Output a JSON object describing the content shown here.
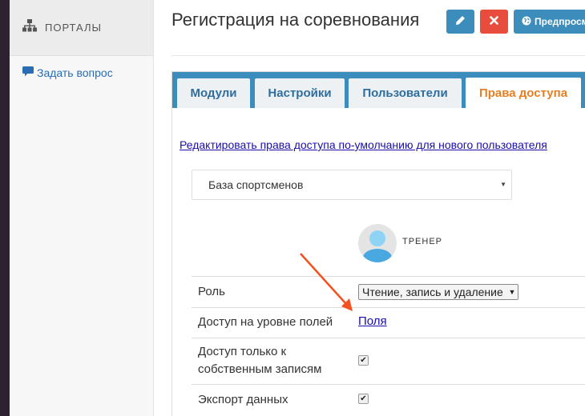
{
  "sidebar": {
    "portals_label": "ПОРТАЛЫ",
    "ask_label": "Задать вопрос"
  },
  "header": {
    "title": "Регистрация на соревнования",
    "preview_label": "Предпросмотр"
  },
  "tabs": [
    {
      "label": "Модули"
    },
    {
      "label": "Настройки"
    },
    {
      "label": "Пользователи"
    },
    {
      "label": "Права доступа",
      "active": true
    }
  ],
  "content": {
    "edit_default_link": "Редактировать права доступа по-умолчанию для нового пользователя",
    "database_select": "База спортсменов",
    "role_name": "ТРЕНЕР",
    "rows": [
      {
        "label": "Роль",
        "value": "Чтение, запись и удаление"
      },
      {
        "label": "Доступ на уровне полей",
        "value": "Поля"
      },
      {
        "label_line1": "Доступ только к",
        "label_line2": "собственным записям",
        "checked": true
      },
      {
        "label": "Экспорт данных",
        "checked": true
      }
    ]
  },
  "colors": {
    "accent": "#3c8dbc",
    "danger": "#e74c3c",
    "active_tab": "#e67e22",
    "arrow": "#f4511e"
  }
}
